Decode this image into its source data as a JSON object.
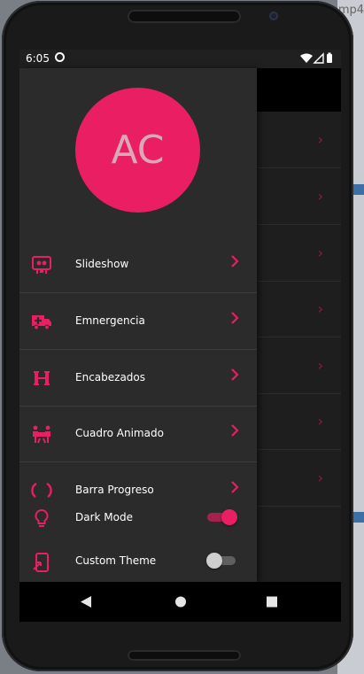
{
  "desktop": {
    "partial_label": "mp4"
  },
  "status_bar": {
    "time": "6:05"
  },
  "avatar": {
    "initials": "AC",
    "color": "#e91e63"
  },
  "menu": {
    "items": [
      {
        "label": "Slideshow",
        "icon": "slideshow-icon"
      },
      {
        "label": "Emnergencia",
        "icon": "ambulance-icon"
      },
      {
        "label": "Encabezados",
        "icon": "header-h-icon"
      },
      {
        "label": "Cuadro Animado",
        "icon": "people-animated-icon"
      },
      {
        "label": "Barra Progreso",
        "icon": "progress-ring-icon"
      }
    ]
  },
  "settings": {
    "dark_mode": {
      "label": "Dark Mode",
      "on": true,
      "icon": "lightbulb-icon"
    },
    "custom_theme": {
      "label": "Custom Theme",
      "on": false,
      "icon": "phone-theme-icon"
    }
  },
  "theme": {
    "accent": "#e91e63",
    "drawer_bg": "#2b2b2b",
    "screen_bg": "#1e1e1e"
  }
}
